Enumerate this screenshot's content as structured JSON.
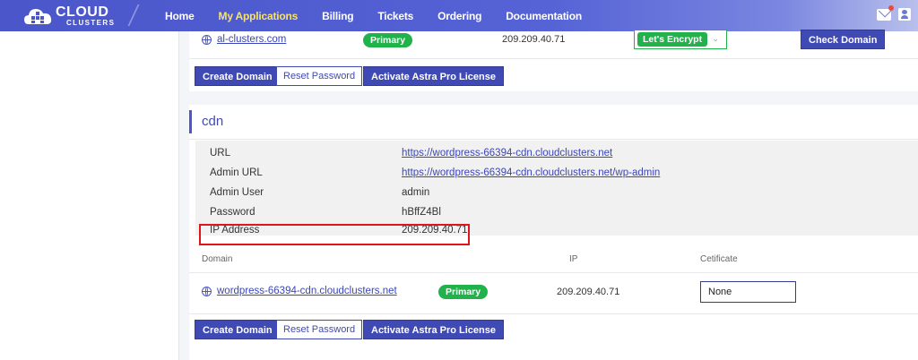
{
  "brand": {
    "line1": "CLOUD",
    "line2": "CLUSTERS"
  },
  "nav": [
    {
      "label": "Home",
      "active": false
    },
    {
      "label": "My Applications",
      "active": true
    },
    {
      "label": "Billing",
      "active": false
    },
    {
      "label": "Tickets",
      "active": false
    },
    {
      "label": "Ordering",
      "active": false
    },
    {
      "label": "Documentation",
      "active": false
    }
  ],
  "top_icons": [
    "mail-icon",
    "user-icon"
  ],
  "app1": {
    "domain": "al-clusters.com",
    "badge": "Primary",
    "ip": "209.209.40.71",
    "certificate": "Let's Encrypt",
    "check_domain": "Check Domain",
    "buttons": {
      "create_domain": "Create Domain",
      "reset_password": "Reset Password",
      "astra": "Activate Astra Pro License"
    }
  },
  "app2": {
    "title": "cdn",
    "info": [
      {
        "key": "URL",
        "value": "https://wordpress-66394-cdn.cloudclusters.net",
        "link": true
      },
      {
        "key": "Admin URL",
        "value": "https://wordpress-66394-cdn.cloudclusters.net/wp-admin",
        "link": true
      },
      {
        "key": "Admin User",
        "value": "admin",
        "link": false
      },
      {
        "key": "Password",
        "value": "hBffZ4Bl",
        "link": false
      },
      {
        "key": "IP Address",
        "value": "209.209.40.71",
        "link": false
      }
    ],
    "columns": {
      "domain": "Domain",
      "ip": "IP",
      "certificate": "Cetificate"
    },
    "domain_row": {
      "domain": "wordpress-66394-cdn.cloudclusters.net",
      "badge": "Primary",
      "ip": "209.209.40.71",
      "certificate": "None"
    },
    "buttons": {
      "create_domain": "Create Domain",
      "reset_password": "Reset Password",
      "astra": "Activate Astra Pro License"
    }
  },
  "colors": {
    "nav": "#4a56c9",
    "active_nav": "#f6e36b",
    "primary_badge": "#21b24b",
    "highlight": "#e0141b"
  }
}
